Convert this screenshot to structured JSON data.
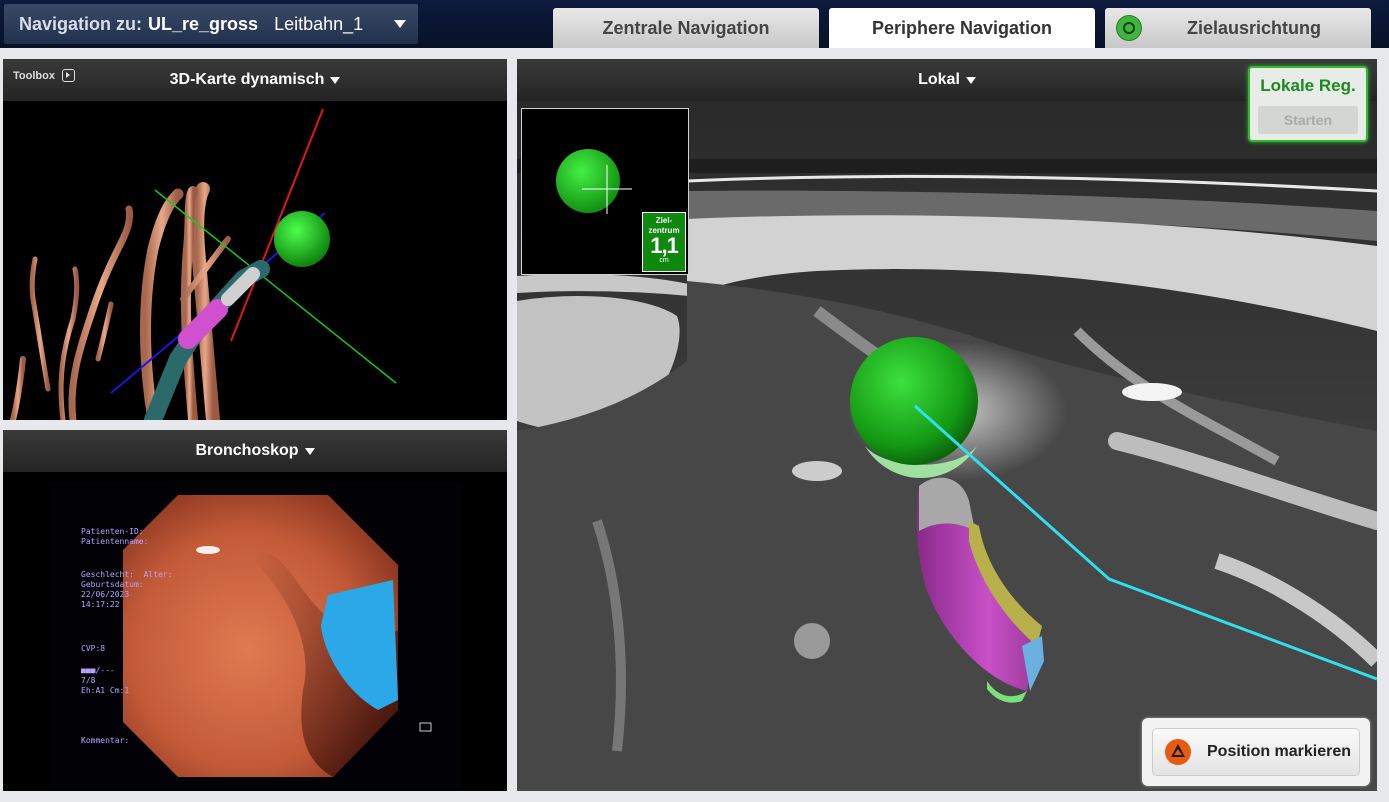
{
  "nav": {
    "label": "Navigation zu:",
    "target": "UL_re_gross",
    "route": "Leitbahn_1"
  },
  "tabs": [
    {
      "label": "Zentrale Navigation"
    },
    {
      "label": "Periphere Navigation",
      "active": true
    },
    {
      "label": "Zielausrichtung"
    }
  ],
  "map3d": {
    "toolbox": "Toolbox",
    "title": "3D-Karte dynamisch"
  },
  "bronchoscope": {
    "title": "Bronchoskop",
    "overlay": {
      "patient_id": "Patienten-ID:",
      "patient_name": "Patientenname:",
      "sex_age": "Geschlecht:  Alter:",
      "birthdate": "Geburtsdatum:",
      "date": "22/06/2023",
      "time": "14:17:22",
      "cvp": "CVP:8",
      "bars": "■■■/---",
      "ratio": "7/8",
      "eh": "Eh:A1 Cm:1",
      "comment": "Kommentar:"
    }
  },
  "local": {
    "title": "Lokal",
    "target_inset": {
      "label_line1": "Ziel-",
      "label_line2": "zentrum",
      "value": "1,1",
      "unit": "cm"
    },
    "registration": {
      "title": "Lokale Reg.",
      "button": "Starten"
    },
    "mark_button": "Position markieren"
  },
  "colors": {
    "target_green": "#22b022",
    "path_cyan": "#2ee0f0",
    "header_dark": "#0c1a3c",
    "accent_orange": "#e85a10"
  }
}
